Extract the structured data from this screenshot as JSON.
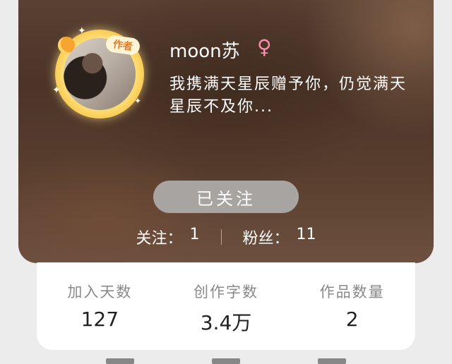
{
  "profile": {
    "author_badge": "作者",
    "username": "moon苏",
    "gender_symbol": "♀",
    "bio": "我携满天星辰赠予你，仍觉满天星辰不及你...",
    "follow_button_label": "已关注",
    "following_label": "关注：",
    "following_count": "1",
    "followers_label": "粉丝：",
    "followers_count": "11"
  },
  "metrics": [
    {
      "label": "加入天数",
      "value": "127"
    },
    {
      "label": "创作字数",
      "value": "3.4万"
    },
    {
      "label": "作品数量",
      "value": "2"
    }
  ],
  "colors": {
    "gender": "#ff8bb1",
    "badge_text": "#e17d2b",
    "follow_button": "#a8a4a2"
  },
  "icons": {
    "gender": "female-symbol-icon",
    "decoration": "sparkle-icon"
  }
}
